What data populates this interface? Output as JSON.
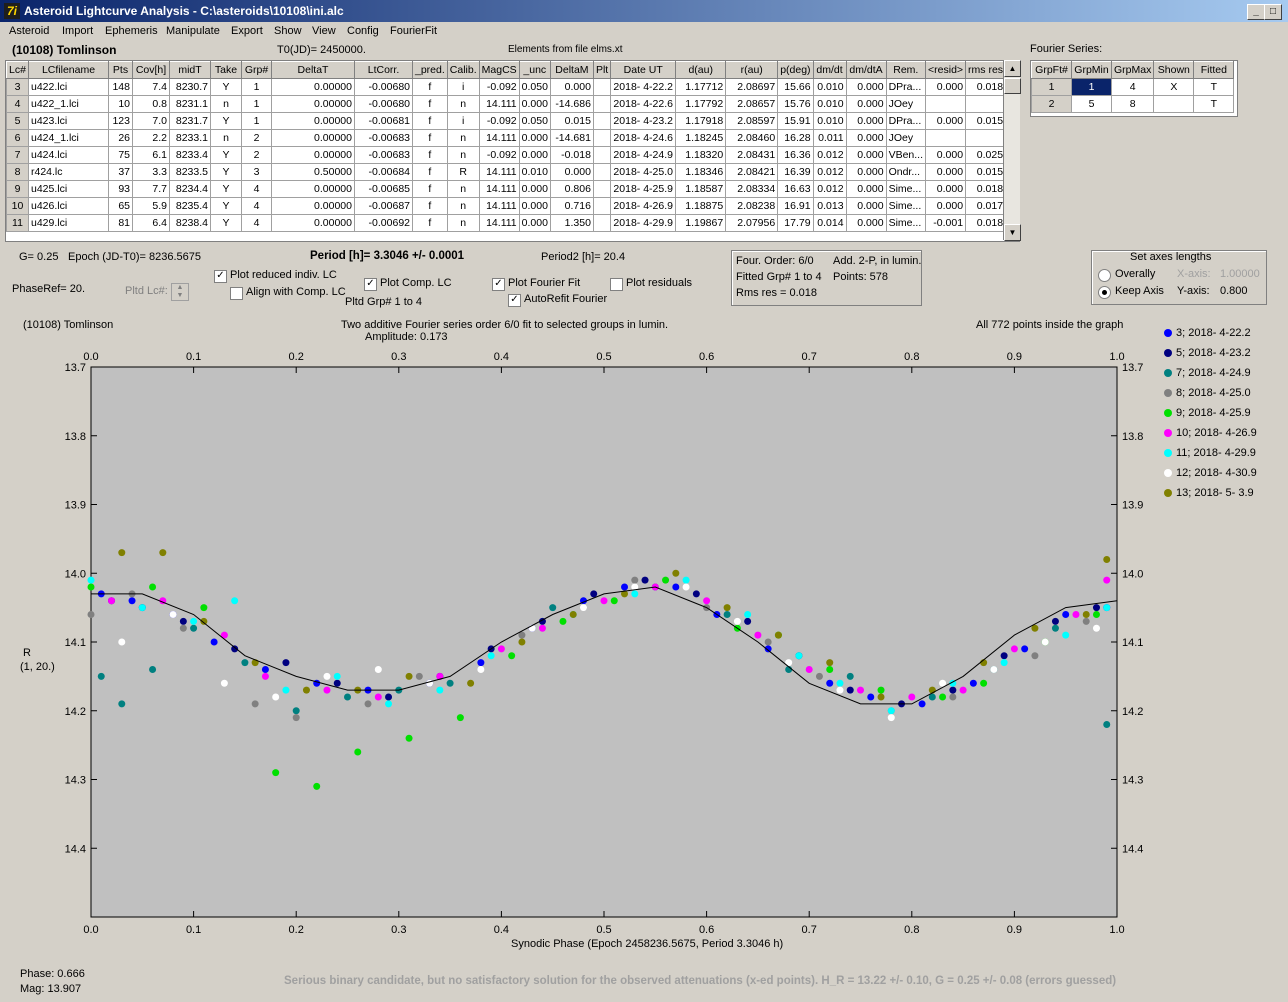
{
  "window": {
    "title": "Asteroid Lightcurve Analysis - C:\\asteroids\\10108\\ini.alc",
    "app_icon": "7i"
  },
  "menu": [
    "Asteroid",
    "Import",
    "Ephemeris",
    "Manipulate",
    "Export",
    "Show",
    "View",
    "Config",
    "FourierFit"
  ],
  "header": {
    "asteroid": "(10108) Tomlinson",
    "t0": "T0(JD)= 2450000.",
    "elements": "Elements from file elms.xt",
    "fourier_title": "Fourier Series:"
  },
  "lc_table": {
    "columns": [
      "Lc#",
      "LCfilename",
      "Pts",
      "Cov[h]",
      "midT",
      "Take",
      "Grp#",
      "DeltaT",
      "LtCorr.",
      "_pred.",
      "Calib.",
      "MagCS",
      "_unc",
      "DeltaM",
      "Plt",
      "Date UT",
      "d(au)",
      "r(au)",
      "p(deg)",
      "dm/dt",
      "dm/dtA",
      "Rem.",
      "<resid>",
      "rms res"
    ],
    "rows": [
      [
        "3",
        "u422.lci",
        "148",
        "7.4",
        "8230.7",
        "Y",
        "1",
        "0.00000",
        "-0.00680",
        "f",
        "i",
        "-0.092",
        "0.050",
        "0.000",
        "",
        "2018- 4-22.2",
        "1.17712",
        "2.08697",
        "15.66",
        "0.010",
        "0.000",
        "DPra...",
        "0.000",
        "0.018"
      ],
      [
        "4",
        "u422_1.lci",
        "10",
        "0.8",
        "8231.1",
        "n",
        "1",
        "0.00000",
        "-0.00680",
        "f",
        "n",
        "14.111",
        "0.000",
        "-14.686",
        "",
        "2018- 4-22.6",
        "1.17792",
        "2.08657",
        "15.76",
        "0.010",
        "0.000",
        "JOey",
        "",
        ""
      ],
      [
        "5",
        "u423.lci",
        "123",
        "7.0",
        "8231.7",
        "Y",
        "1",
        "0.00000",
        "-0.00681",
        "f",
        "i",
        "-0.092",
        "0.050",
        "0.015",
        "",
        "2018- 4-23.2",
        "1.17918",
        "2.08597",
        "15.91",
        "0.010",
        "0.000",
        "DPra...",
        "0.000",
        "0.015"
      ],
      [
        "6",
        "u424_1.lci",
        "26",
        "2.2",
        "8233.1",
        "n",
        "2",
        "0.00000",
        "-0.00683",
        "f",
        "n",
        "14.111",
        "0.000",
        "-14.681",
        "",
        "2018- 4-24.6",
        "1.18245",
        "2.08460",
        "16.28",
        "0.011",
        "0.000",
        "JOey",
        "",
        ""
      ],
      [
        "7",
        "u424.lci",
        "75",
        "6.1",
        "8233.4",
        "Y",
        "2",
        "0.00000",
        "-0.00683",
        "f",
        "n",
        "-0.092",
        "0.000",
        "-0.018",
        "",
        "2018- 4-24.9",
        "1.18320",
        "2.08431",
        "16.36",
        "0.012",
        "0.000",
        "VBen...",
        "0.000",
        "0.025"
      ],
      [
        "8",
        "r424.lc",
        "37",
        "3.3",
        "8233.5",
        "Y",
        "3",
        "0.50000",
        "-0.00684",
        "f",
        "R",
        "14.111",
        "0.010",
        "0.000",
        "",
        "2018- 4-25.0",
        "1.18346",
        "2.08421",
        "16.39",
        "0.012",
        "0.000",
        "Ondr...",
        "0.000",
        "0.015"
      ],
      [
        "9",
        "u425.lci",
        "93",
        "7.7",
        "8234.4",
        "Y",
        "4",
        "0.00000",
        "-0.00685",
        "f",
        "n",
        "14.111",
        "0.000",
        "0.806",
        "",
        "2018- 4-25.9",
        "1.18587",
        "2.08334",
        "16.63",
        "0.012",
        "0.000",
        "Sime...",
        "0.000",
        "0.018"
      ],
      [
        "10",
        "u426.lci",
        "65",
        "5.9",
        "8235.4",
        "Y",
        "4",
        "0.00000",
        "-0.00687",
        "f",
        "n",
        "14.111",
        "0.000",
        "0.716",
        "",
        "2018- 4-26.9",
        "1.18875",
        "2.08238",
        "16.91",
        "0.013",
        "0.000",
        "Sime...",
        "0.000",
        "0.017"
      ],
      [
        "11",
        "u429.lci",
        "81",
        "6.4",
        "8238.4",
        "Y",
        "4",
        "0.00000",
        "-0.00692",
        "f",
        "n",
        "14.111",
        "0.000",
        "1.350",
        "",
        "2018- 4-29.9",
        "1.19867",
        "2.07956",
        "17.79",
        "0.014",
        "0.000",
        "Sime...",
        "-0.001",
        "0.018"
      ]
    ]
  },
  "fourier_table": {
    "columns": [
      "GrpFt#",
      "GrpMin",
      "GrpMax",
      "Shown",
      "Fitted"
    ],
    "rows": [
      [
        "1",
        "1",
        "4",
        "X",
        "T"
      ],
      [
        "2",
        "5",
        "8",
        "",
        "T"
      ]
    ]
  },
  "info": {
    "g": "G= 0.25",
    "epoch": "Epoch (JD-T0)= 8236.5675",
    "period": "Period [h]= 3.3046 +/- 0.0001",
    "period2": "Period2 [h]= 20.4",
    "phaseref": "PhaseRef= 20.",
    "pltd_lc": "Pltd Lc#:",
    "pltd_grp": "Pltd Grp#  1   to   4",
    "four_order": "Four. Order:  6/0",
    "add2p": "Add. 2-P, in lumin.",
    "fitted_grp": "Fitted Grp# 1 to 4",
    "points": "Points: 578",
    "rms": "Rms res     = 0.018"
  },
  "options": {
    "plot_reduced": {
      "label": "Plot reduced indiv. LC",
      "checked": true
    },
    "align_comp": {
      "label": "Align with Comp. LC",
      "checked": false
    },
    "plot_comp": {
      "label": "Plot Comp. LC",
      "checked": true
    },
    "plot_fourier": {
      "label": "Plot Fourier Fit",
      "checked": true
    },
    "plot_residuals": {
      "label": "Plot residuals",
      "checked": false
    },
    "autorefit": {
      "label": "AutoRefit Fourier",
      "checked": true
    }
  },
  "axes_box": {
    "title": "Set axes lengths",
    "overally": "Overally",
    "keep_axis": "Keep Axis",
    "x_axis_label": "X-axis:",
    "x_axis_value": "1.00000",
    "y_axis_label": "Y-axis:",
    "y_axis_value": "0.800",
    "selected": "keep_axis"
  },
  "plot_text": {
    "name": "(10108) Tomlinson",
    "line1": "Two additive Fourier series order 6/0 fit to selected groups in lumin.",
    "line2": "Amplitude: 0.173",
    "right": "All 772 points inside the graph",
    "xlabel": "Synodic Phase (Epoch 2458236.5675, Period 3.3046 h)",
    "ylabel1": "R",
    "ylabel2": "(1, 20.)"
  },
  "footer": {
    "phase": "Phase:  0.666",
    "mag": "Mag:    13.907",
    "note": "Serious binary candidate, but no satisfactory solution for the observed attenuations (x-ed points).   H_R = 13.22 +/- 0.10, G = 0.25 +/- 0.08 (errors guessed)"
  },
  "chart_data": {
    "type": "scatter",
    "xlim": [
      0.0,
      1.0
    ],
    "ylim": [
      13.7,
      14.5
    ],
    "y_inverted": true,
    "x_ticks": [
      "0.0",
      "0.1",
      "0.2",
      "0.3",
      "0.4",
      "0.5",
      "0.6",
      "0.7",
      "0.8",
      "0.9",
      "1.0"
    ],
    "y_ticks": [
      "13.7",
      "13.8",
      "13.9",
      "14.0",
      "14.1",
      "14.2",
      "14.3",
      "14.4"
    ],
    "grid": false,
    "legend_position": "right",
    "fit_curve": {
      "x": [
        0.0,
        0.05,
        0.1,
        0.15,
        0.2,
        0.25,
        0.3,
        0.35,
        0.4,
        0.45,
        0.5,
        0.55,
        0.6,
        0.65,
        0.7,
        0.75,
        0.8,
        0.85,
        0.9,
        0.95,
        1.0
      ],
      "y": [
        14.03,
        14.03,
        14.06,
        14.12,
        14.15,
        14.17,
        14.17,
        14.15,
        14.1,
        14.06,
        14.03,
        14.02,
        14.05,
        14.1,
        14.16,
        14.19,
        14.19,
        14.15,
        14.09,
        14.05,
        14.04
      ]
    },
    "series": [
      {
        "name": "3; 2018- 4-22.2",
        "color": "#0000ff",
        "x": [
          0.01,
          0.04,
          0.08,
          0.12,
          0.17,
          0.22,
          0.27,
          0.33,
          0.38,
          0.43,
          0.48,
          0.52,
          0.57,
          0.61,
          0.66,
          0.72,
          0.76,
          0.81,
          0.86,
          0.91,
          0.95,
          0.99
        ],
        "y": [
          14.03,
          14.04,
          14.06,
          14.1,
          14.14,
          14.16,
          14.17,
          14.16,
          14.13,
          14.08,
          14.04,
          14.02,
          14.02,
          14.06,
          14.11,
          14.16,
          14.18,
          14.19,
          14.16,
          14.11,
          14.06,
          14.05
        ]
      },
      {
        "name": "5; 2018- 4-23.2",
        "color": "#000080",
        "x": [
          0.02,
          0.05,
          0.09,
          0.14,
          0.19,
          0.24,
          0.29,
          0.34,
          0.39,
          0.44,
          0.49,
          0.54,
          0.59,
          0.64,
          0.69,
          0.74,
          0.79,
          0.84,
          0.89,
          0.94,
          0.98
        ],
        "y": [
          14.04,
          14.05,
          14.07,
          14.11,
          14.13,
          14.16,
          14.18,
          14.15,
          14.11,
          14.07,
          14.03,
          14.01,
          14.03,
          14.07,
          14.12,
          14.17,
          14.19,
          14.17,
          14.12,
          14.07,
          14.05
        ]
      },
      {
        "name": "7; 2018- 4-24.9",
        "color": "#008080",
        "x": [
          0.01,
          0.03,
          0.06,
          0.1,
          0.15,
          0.2,
          0.25,
          0.3,
          0.35,
          0.45,
          0.55,
          0.62,
          0.68,
          0.74,
          0.82,
          0.88,
          0.94,
          0.99
        ],
        "y": [
          14.15,
          14.19,
          14.14,
          14.08,
          14.13,
          14.2,
          14.18,
          14.17,
          14.16,
          14.05,
          14.02,
          14.06,
          14.14,
          14.15,
          14.18,
          14.14,
          14.08,
          14.22
        ]
      },
      {
        "name": "8; 2018- 4-25.0",
        "color": "#808080",
        "x": [
          0.0,
          0.04,
          0.09,
          0.16,
          0.2,
          0.27,
          0.32,
          0.42,
          0.48,
          0.53,
          0.6,
          0.66,
          0.71,
          0.78,
          0.84,
          0.92,
          0.97
        ],
        "y": [
          14.06,
          14.03,
          14.08,
          14.19,
          14.21,
          14.19,
          14.15,
          14.09,
          14.05,
          14.01,
          14.05,
          14.1,
          14.15,
          14.2,
          14.18,
          14.12,
          14.07
        ]
      },
      {
        "name": "9; 2018- 4-25.9",
        "color": "#00e000",
        "x": [
          0.0,
          0.06,
          0.11,
          0.18,
          0.22,
          0.26,
          0.31,
          0.36,
          0.41,
          0.46,
          0.51,
          0.56,
          0.63,
          0.67,
          0.72,
          0.77,
          0.83,
          0.87,
          0.93,
          0.98
        ],
        "y": [
          14.02,
          14.02,
          14.05,
          14.29,
          14.31,
          14.26,
          14.24,
          14.21,
          14.12,
          14.07,
          14.04,
          14.01,
          14.08,
          14.09,
          14.14,
          14.17,
          14.18,
          14.16,
          14.1,
          14.06
        ]
      },
      {
        "name": "10; 2018- 4-26.9",
        "color": "#ff00ff",
        "x": [
          0.02,
          0.07,
          0.13,
          0.17,
          0.23,
          0.28,
          0.34,
          0.4,
          0.44,
          0.5,
          0.55,
          0.6,
          0.65,
          0.7,
          0.75,
          0.8,
          0.85,
          0.9,
          0.96,
          0.99
        ],
        "y": [
          14.04,
          14.04,
          14.09,
          14.15,
          14.17,
          14.18,
          14.15,
          14.11,
          14.08,
          14.04,
          14.02,
          14.04,
          14.09,
          14.14,
          14.17,
          14.18,
          14.17,
          14.11,
          14.06,
          14.01
        ]
      },
      {
        "name": "11; 2018- 4-29.9",
        "color": "#00ffff",
        "x": [
          0.0,
          0.05,
          0.1,
          0.14,
          0.19,
          0.24,
          0.29,
          0.34,
          0.39,
          0.47,
          0.53,
          0.58,
          0.64,
          0.69,
          0.73,
          0.78,
          0.84,
          0.89,
          0.95,
          0.99
        ],
        "y": [
          14.01,
          14.05,
          14.07,
          14.04,
          14.17,
          14.15,
          14.19,
          14.17,
          14.12,
          14.06,
          14.03,
          14.01,
          14.06,
          14.12,
          14.16,
          14.2,
          14.16,
          14.13,
          14.09,
          14.05
        ]
      },
      {
        "name": "12; 2018- 4-30.9",
        "color": "#ffffff",
        "x": [
          0.03,
          0.08,
          0.13,
          0.18,
          0.23,
          0.28,
          0.33,
          0.38,
          0.43,
          0.48,
          0.53,
          0.58,
          0.63,
          0.68,
          0.73,
          0.78,
          0.83,
          0.88,
          0.93,
          0.98
        ],
        "y": [
          14.1,
          14.06,
          14.16,
          14.18,
          14.15,
          14.14,
          14.16,
          14.14,
          14.08,
          14.05,
          14.02,
          14.02,
          14.07,
          14.13,
          14.17,
          14.21,
          14.16,
          14.14,
          14.1,
          14.08
        ]
      },
      {
        "name": "13; 2018- 5- 3.9",
        "color": "#808000",
        "x": [
          0.03,
          0.07,
          0.11,
          0.16,
          0.21,
          0.26,
          0.31,
          0.37,
          0.42,
          0.47,
          0.52,
          0.57,
          0.62,
          0.67,
          0.72,
          0.77,
          0.82,
          0.87,
          0.92,
          0.97,
          0.99
        ],
        "y": [
          13.97,
          13.97,
          14.07,
          14.13,
          14.17,
          14.17,
          14.15,
          14.16,
          14.1,
          14.06,
          14.03,
          14.0,
          14.05,
          14.09,
          14.13,
          14.18,
          14.17,
          14.13,
          14.08,
          14.06,
          13.98
        ]
      }
    ]
  }
}
